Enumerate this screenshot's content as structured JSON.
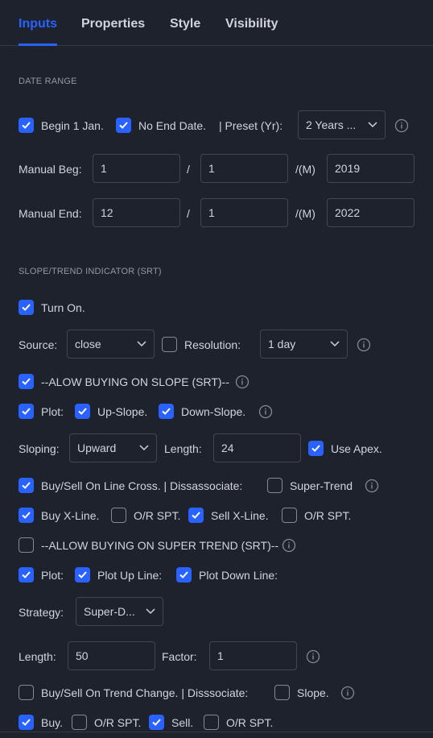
{
  "tabs": [
    "Inputs",
    "Properties",
    "Style",
    "Visibility"
  ],
  "date_range": {
    "section_title": "DATE RANGE",
    "begin_label": "Begin 1 Jan.",
    "no_end_label": "No End Date.",
    "preset_label": "| Preset (Yr):",
    "preset_value": "2 Years ...",
    "manual_beg_label": "Manual Beg:",
    "manual_beg": [
      "1",
      "1",
      "2019"
    ],
    "manual_end_label": "Manual End:",
    "manual_end": [
      "12",
      "1",
      "2022"
    ],
    "slash": "/",
    "month_sep": "/(M)"
  },
  "srt": {
    "section_title": "SLOPE/TREND INDICATOR (SRT)",
    "turn_on": "Turn On.",
    "source_label": "Source:",
    "source_value": "close",
    "resolution_label": "Resolution:",
    "resolution_value": "1 day",
    "allow_slope": "--ALOW BUYING ON SLOPE (SRT)--",
    "plot": "Plot:",
    "up_slope": "Up-Slope.",
    "down_slope": "Down-Slope.",
    "sloping_label": "Sloping:",
    "sloping_value": "Upward",
    "length_label": "Length:",
    "length_value": "24",
    "use_apex": "Use Apex.",
    "buy_sell_cross": "Buy/Sell On Line Cross. | Dissassociate:",
    "super_trend": "Super-Trend",
    "buy_xline": "Buy X-Line.",
    "or_spt": "O/R SPT.",
    "sell_xline": "Sell X-Line.",
    "allow_super": "--ALLOW BUYING ON SUPER TREND (SRT)--",
    "plot_up_line": "Plot Up Line:",
    "plot_down_line": "Plot Down Line:",
    "strategy_label": "Strategy:",
    "strategy_value": "Super-D...",
    "length2_value": "50",
    "factor_label": "Factor:",
    "factor_value": "1",
    "buy_sell_trend": "Buy/Sell On Trend Change. | Disssociate:",
    "slope": "Slope.",
    "buy": "Buy.",
    "sell": "Sell."
  },
  "colors": {
    "accent": "#2962ff",
    "background": "#1e222d",
    "text": "#d1d4dc"
  }
}
